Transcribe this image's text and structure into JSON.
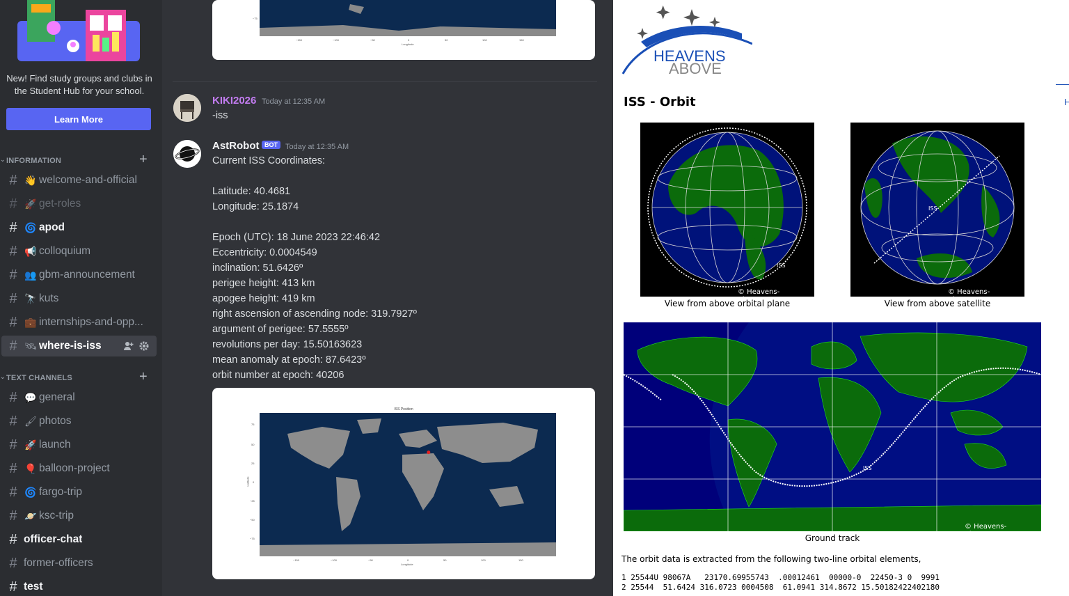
{
  "sidebar": {
    "promo_text": "New! Find study groups and clubs in the Student Hub for your school.",
    "learn_more": "Learn More",
    "categories": [
      {
        "label": "INFORMATION"
      },
      {
        "label": "TEXT CHANNELS"
      }
    ],
    "channels": [
      {
        "name": "welcome-and-official",
        "icon": "waving-hand-icon"
      },
      {
        "name": "get-roles",
        "icon": "rocket-icon"
      },
      {
        "name": "apod",
        "icon": "galaxy-icon"
      },
      {
        "name": "colloquium",
        "icon": "megaphone-icon"
      },
      {
        "name": "gbm-announcement",
        "icon": "people-icon"
      },
      {
        "name": "kuts",
        "icon": "telescope-icon"
      },
      {
        "name": "internships-and-opp...",
        "icon": "briefcase-icon"
      },
      {
        "name": "where-is-iss",
        "icon": "satellite-icon"
      },
      {
        "name": "general",
        "icon": "speech-bubble-icon"
      },
      {
        "name": "photos",
        "icon": "paintbrush-icon"
      },
      {
        "name": "launch",
        "icon": "rocket-icon"
      },
      {
        "name": "balloon-project",
        "icon": "balloon-icon"
      },
      {
        "name": "fargo-trip",
        "icon": "galaxy-icon"
      },
      {
        "name": "ksc-trip",
        "icon": "planet-icon"
      },
      {
        "name": "officer-chat",
        "icon": ""
      },
      {
        "name": "former-officers",
        "icon": ""
      },
      {
        "name": "test",
        "icon": ""
      }
    ]
  },
  "chat": {
    "top_map": {
      "x_ticks": [
        "−150",
        "−100",
        "−50",
        "0",
        "50",
        "100",
        "150"
      ],
      "x_label": "Longitude",
      "y_tick": "−75"
    },
    "messages": [
      {
        "author": "KIKI2026",
        "timestamp": "Today at 12:35 AM",
        "text": "-iss",
        "author_color": "#c27cf0"
      },
      {
        "author": "AstRobot",
        "badge": "BOT",
        "timestamp": "Today at 12:35 AM",
        "author_color": "#f2f3f5",
        "lines": [
          "Current ISS Coordinates:",
          "",
          "Latitude: 40.4681",
          "Longitude: 25.1874",
          "",
          "Epoch (UTC): 18 June 2023 22:46:42",
          "Eccentricity: 0.0004549",
          "inclination: 51.6426º",
          "perigee height: 413 km",
          "apogee height: 419 km",
          "right ascension of ascending node: 319.7927º",
          "argument of perigee: 57.5555º",
          "revolutions per day: 15.50163623",
          "mean anomaly at epoch: 87.6423º",
          "orbit number at epoch: 40206"
        ]
      }
    ],
    "iss_map": {
      "title": "ISS Position",
      "y_label": "Latitude",
      "x_label": "Longitude",
      "y_ticks": [
        "75",
        "50",
        "25",
        "0",
        "−25",
        "−50",
        "−75"
      ],
      "x_ticks": [
        "−150",
        "−100",
        "−50",
        "0",
        "50",
        "100",
        "150"
      ],
      "marker_lat": 40.4681,
      "marker_lon": 25.1874
    }
  },
  "heavens_above": {
    "logo_top": "HEAVENS",
    "logo_bottom": "ABOVE",
    "title": "ISS - Orbit",
    "corner_text": "H",
    "globe1_caption": "View from above orbital plane",
    "globe2_caption": "View from above satellite",
    "copyright": "© Heavens-Above.com",
    "track_caption": "Ground track",
    "description": "The orbit data is extracted from the following two-line orbital elements,",
    "tle_line1": "1 25544U 98067A   23170.69955743  .00012461  00000-0  22450-3 0  9991",
    "tle_line2": "2 25544  51.6424 316.0723 0004508  61.0941 314.8672 15.50182422402180"
  }
}
